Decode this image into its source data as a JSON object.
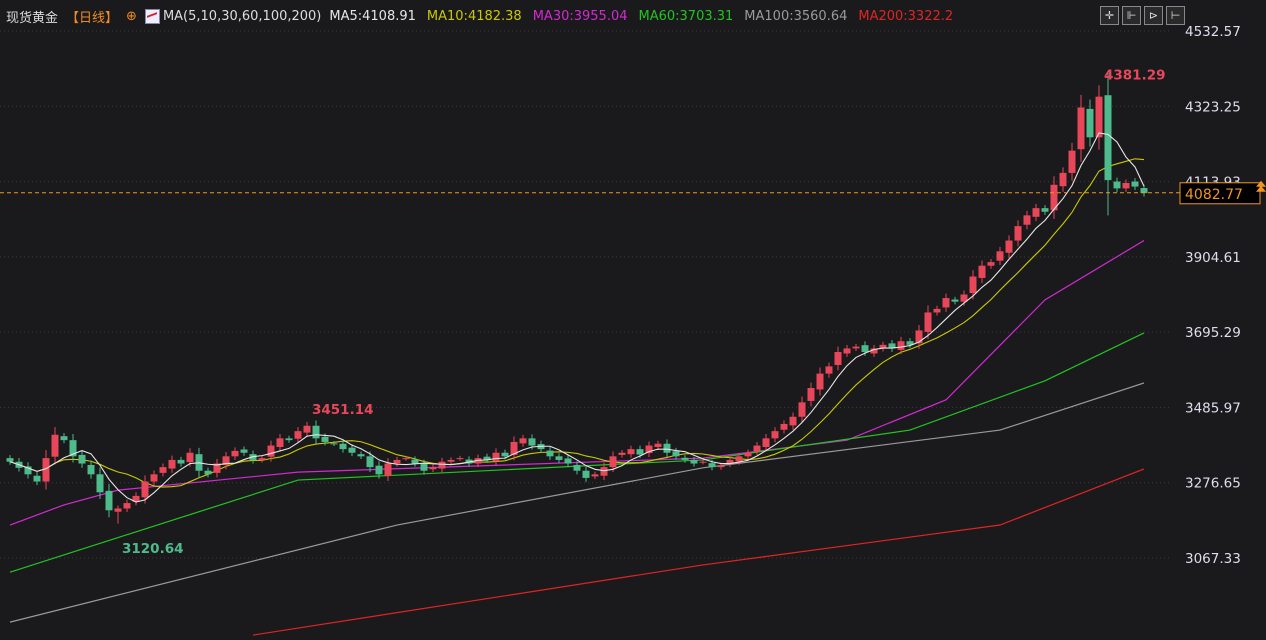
{
  "header": {
    "instrument": "现货黄金",
    "timeframe": "【日线】",
    "ma_label": "MA(5,10,30,60,100,200)",
    "ma_values": [
      {
        "text": "MA5:4108.91",
        "color": "#e6e6e6"
      },
      {
        "text": "MA10:4182.38",
        "color": "#c9c900"
      },
      {
        "text": "MA30:3955.04",
        "color": "#d22ad2"
      },
      {
        "text": "MA60:3703.31",
        "color": "#22c322"
      },
      {
        "text": "MA100:3560.64",
        "color": "#9a9a9a"
      },
      {
        "text": "MA200:3322.2",
        "color": "#e02424"
      }
    ]
  },
  "toolbar": {
    "icons": [
      "crosshair-icon",
      "zoom-in-icon",
      "play-icon",
      "exit-icon"
    ],
    "glyphs": [
      "✛",
      "⊩",
      "⊳",
      "⊢"
    ]
  },
  "chart_data": {
    "type": "candlestick",
    "title": "现货黄金 日线",
    "ylim": [
      3067.33,
      4532.57
    ],
    "yticks": [
      "4532.57",
      "4323.25",
      "4113.93",
      "3904.61",
      "3695.29",
      "3485.97",
      "3276.65",
      "3067.33"
    ],
    "last_price": "4082.77",
    "colors": {
      "up": "#e8475a",
      "down": "#4dbb8b",
      "last": "#f0961e"
    },
    "close": [
      3335,
      3318,
      3300,
      3280,
      3345,
      3410,
      3395,
      3350,
      3330,
      3300,
      3250,
      3200,
      3205,
      3220,
      3240,
      3280,
      3300,
      3320,
      3340,
      3330,
      3360,
      3310,
      3300,
      3330,
      3350,
      3365,
      3360,
      3340,
      3345,
      3380,
      3400,
      3395,
      3420,
      3435,
      3400,
      3390,
      3385,
      3370,
      3360,
      3350,
      3320,
      3300,
      3330,
      3340,
      3345,
      3330,
      3310,
      3320,
      3335,
      3340,
      3345,
      3330,
      3345,
      3340,
      3360,
      3350,
      3390,
      3400,
      3380,
      3370,
      3350,
      3340,
      3330,
      3310,
      3290,
      3300,
      3320,
      3350,
      3360,
      3370,
      3355,
      3380,
      3385,
      3360,
      3350,
      3340,
      3330,
      3335,
      3320,
      3325,
      3340,
      3350,
      3360,
      3380,
      3400,
      3420,
      3440,
      3460,
      3500,
      3540,
      3580,
      3600,
      3640,
      3650,
      3655,
      3640,
      3650,
      3660,
      3650,
      3670,
      3660,
      3700,
      3750,
      3760,
      3790,
      3780,
      3800,
      3850,
      3880,
      3890,
      3920,
      3950,
      3990,
      4020,
      4040,
      4030,
      4105,
      4138,
      4200,
      4320,
      4237,
      4350,
      4118,
      4095,
      4110,
      4100,
      4082
    ],
    "annotations": [
      {
        "text": "3451.14",
        "price": 3451.14,
        "index": 33,
        "color": "#e8475a"
      },
      {
        "text": "3120.64",
        "price": 3120.64,
        "index": 12,
        "color": "#4dbb8b"
      },
      {
        "text": "4381.29",
        "price": 4381.29,
        "index": 121,
        "color": "#e8475a"
      }
    ],
    "ma_series": [
      {
        "name": "MA30",
        "color": "#d22ad2",
        "points": [
          [
            0,
            3159
          ],
          [
            6,
            3215
          ],
          [
            12,
            3256
          ],
          [
            32,
            3306
          ],
          [
            77,
            3345
          ],
          [
            93,
            3395
          ],
          [
            104,
            3507
          ],
          [
            115,
            3785
          ],
          [
            126,
            3950
          ]
        ]
      },
      {
        "name": "MA60",
        "color": "#22c322",
        "points": [
          [
            0,
            3028
          ],
          [
            32,
            3284
          ],
          [
            77,
            3340
          ],
          [
            100,
            3423
          ],
          [
            115,
            3560
          ],
          [
            126,
            3693
          ]
        ]
      },
      {
        "name": "MA100",
        "color": "#9a9a9a",
        "points": [
          [
            0,
            2889
          ],
          [
            43,
            3159
          ],
          [
            77,
            3318
          ],
          [
            110,
            3423
          ],
          [
            126,
            3554
          ]
        ]
      },
      {
        "name": "MA200",
        "color": "#e02424",
        "points": [
          [
            27,
            2853
          ],
          [
            77,
            3048
          ],
          [
            110,
            3159
          ],
          [
            126,
            3315
          ]
        ]
      }
    ]
  }
}
